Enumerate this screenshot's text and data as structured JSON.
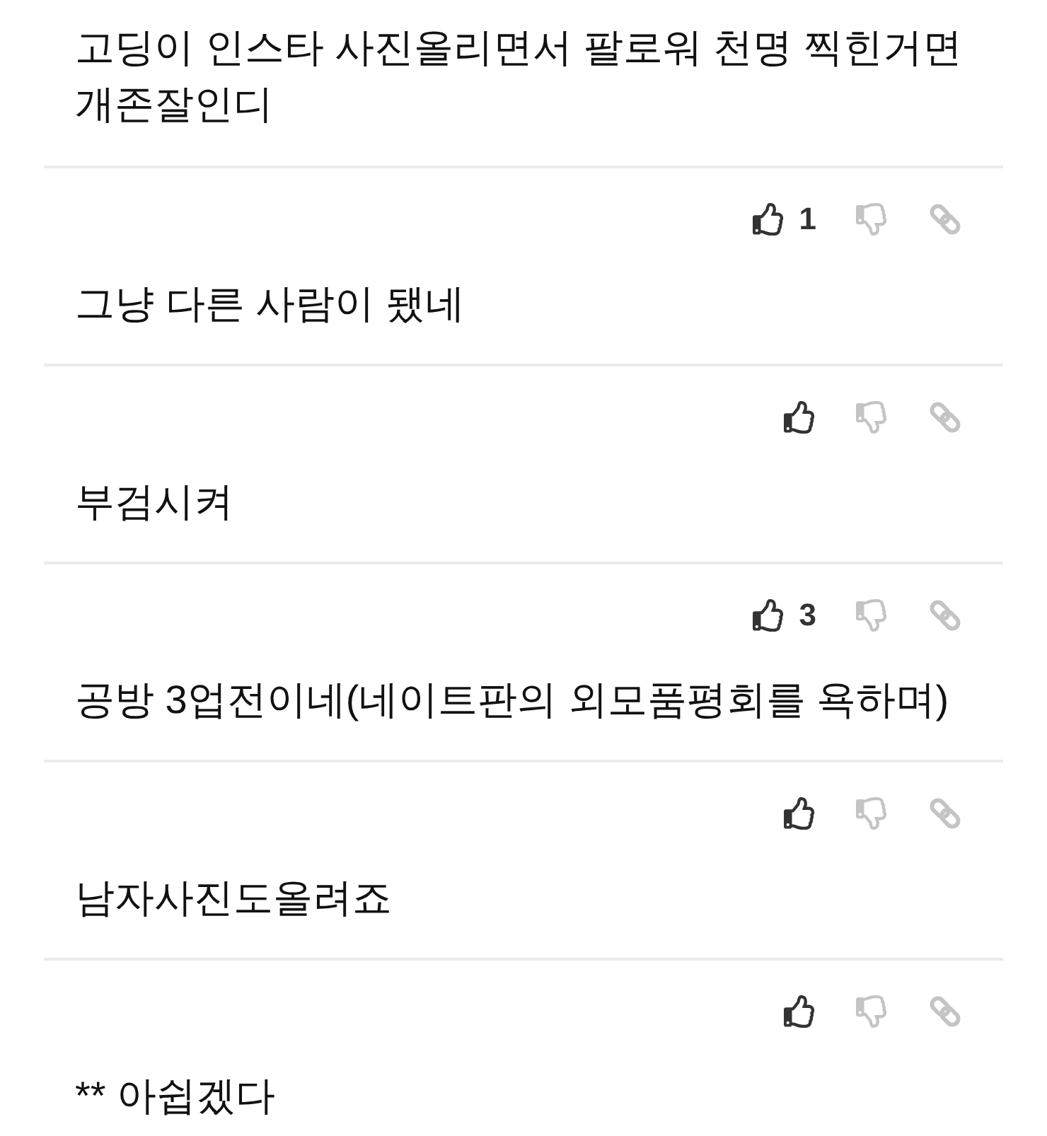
{
  "rows": [
    {
      "kind": "comment",
      "text": "고딩이 인스타 사진올리면서 팔로워 천명 찍힌거면 개존잘인디"
    },
    {
      "kind": "votes",
      "likes": "1"
    },
    {
      "kind": "comment",
      "text": "그냥 다른 사람이 됐네"
    },
    {
      "kind": "votes"
    },
    {
      "kind": "comment",
      "text": "부검시켜"
    },
    {
      "kind": "votes",
      "likes": "3"
    },
    {
      "kind": "comment",
      "text": "공방 3업전이네(네이트판의 외모품평회를 욕하며)"
    },
    {
      "kind": "votes"
    },
    {
      "kind": "comment",
      "text": "남자사진도올려죠"
    },
    {
      "kind": "votes"
    },
    {
      "kind": "comment",
      "text": "** 아쉽겠다"
    }
  ]
}
